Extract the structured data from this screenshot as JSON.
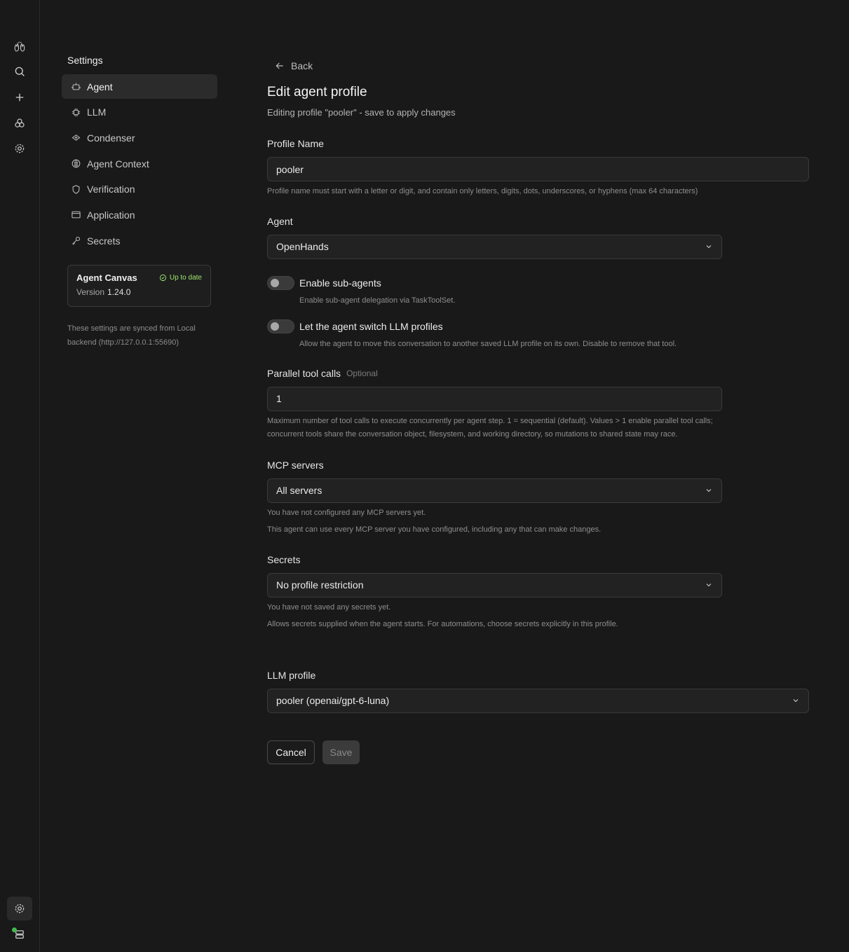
{
  "sidebar": {
    "title": "Settings",
    "items": [
      {
        "label": "Agent",
        "icon": "robot-icon"
      },
      {
        "label": "LLM",
        "icon": "chip-icon"
      },
      {
        "label": "Condenser",
        "icon": "condenser-icon"
      },
      {
        "label": "Agent Context",
        "icon": "brain-icon"
      },
      {
        "label": "Verification",
        "icon": "shield-icon"
      },
      {
        "label": "Application",
        "icon": "window-icon"
      },
      {
        "label": "Secrets",
        "icon": "key-icon"
      }
    ],
    "version_card": {
      "name": "Agent Canvas",
      "status": "Up to date",
      "version_label": "Version",
      "version": "1.24.0"
    },
    "sync_note": "These settings are synced from Local backend (http://127.0.0.1:55690)"
  },
  "main": {
    "back": "Back",
    "title": "Edit agent profile",
    "subtitle": "Editing profile \"pooler\" - save to apply changes",
    "profile_name": {
      "label": "Profile Name",
      "value": "pooler",
      "help": "Profile name must start with a letter or digit, and contain only letters, digits, dots, underscores, or hyphens (max 64 characters)"
    },
    "agent": {
      "label": "Agent",
      "value": "OpenHands"
    },
    "sub_agents": {
      "title": "Enable sub-agents",
      "desc": "Enable sub-agent delegation via TaskToolSet.",
      "enabled": false
    },
    "switch_llm": {
      "title": "Let the agent switch LLM profiles",
      "desc": "Allow the agent to move this conversation to another saved LLM profile on its own. Disable to remove that tool.",
      "enabled": false
    },
    "parallel": {
      "label": "Parallel tool calls",
      "optional": "Optional",
      "value": "1",
      "help": "Maximum number of tool calls to execute concurrently per agent step. 1 = sequential (default). Values > 1 enable parallel tool calls; concurrent tools share the conversation object, filesystem, and working directory, so mutations to shared state may race."
    },
    "mcp": {
      "label": "MCP servers",
      "value": "All servers",
      "help1": "You have not configured any MCP servers yet.",
      "help2": "This agent can use every MCP server you have configured, including any that can make changes."
    },
    "secrets": {
      "label": "Secrets",
      "value": "No profile restriction",
      "help1": "You have not saved any secrets yet.",
      "help2": "Allows secrets supplied when the agent starts. For automations, choose secrets explicitly in this profile."
    },
    "llm_profile": {
      "label": "LLM profile",
      "value": "pooler (openai/gpt-6-luna)"
    },
    "cancel": "Cancel",
    "save": "Save"
  }
}
